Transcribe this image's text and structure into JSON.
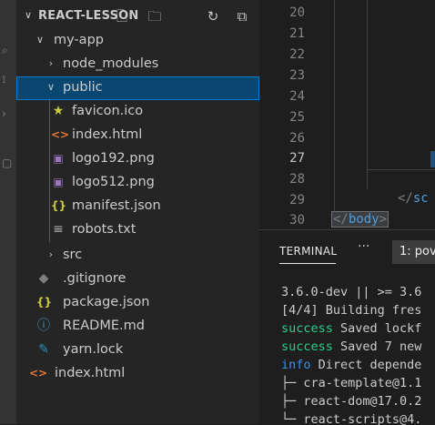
{
  "explorer": {
    "title": "REACT-LESSON",
    "actions": [
      "new-file-icon",
      "new-folder-icon",
      "refresh-icon",
      "collapse-all-icon"
    ]
  },
  "tree": {
    "my_app": "my-app",
    "node_modules": "node_modules",
    "public": "public",
    "favicon": "favicon.ico",
    "index_html_public": "index.html",
    "logo192": "logo192.png",
    "logo512": "logo512.png",
    "manifest": "manifest.json",
    "robots": "robots.txt",
    "src": "src",
    "gitignore": ".gitignore",
    "package_json": "package.json",
    "readme": "README.md",
    "yarn_lock": "yarn.lock",
    "index_html_root": "index.html"
  },
  "editor": {
    "line_numbers": [
      "20",
      "21",
      "22",
      "23",
      "24",
      "25",
      "26",
      "27",
      "28",
      "29",
      "30"
    ],
    "active_line": "27",
    "code_29": "</sc",
    "code_30": "</body>"
  },
  "panel": {
    "tab_terminal": "TERMINAL",
    "more": "···",
    "terminal_select": "1: pov"
  },
  "terminal": {
    "lines": [
      "3.6.0-dev || >= 3.6",
      "[4/4] Building fres",
      "success Saved lockf",
      "success Saved 7 new",
      "info Direct depende",
      "├─ cra-template@1.1",
      "├─ react-dom@17.0.2",
      "└─ react-scripts@4."
    ],
    "success_word": "success",
    "info_word": "info",
    "line3_rest": " Saved lockf",
    "line4_rest": " Saved 7 new",
    "line5_rest": " Direct depende"
  },
  "colors": {
    "selection": "#094771",
    "selection_border": "#007fd4",
    "html_icon": "#e37933",
    "json_icon": "#cbcb41",
    "image_icon": "#a074c4",
    "info_icon": "#519aba",
    "yarn_icon": "#2c8ebb",
    "success": "#23d18b",
    "info": "#3b8eea"
  }
}
